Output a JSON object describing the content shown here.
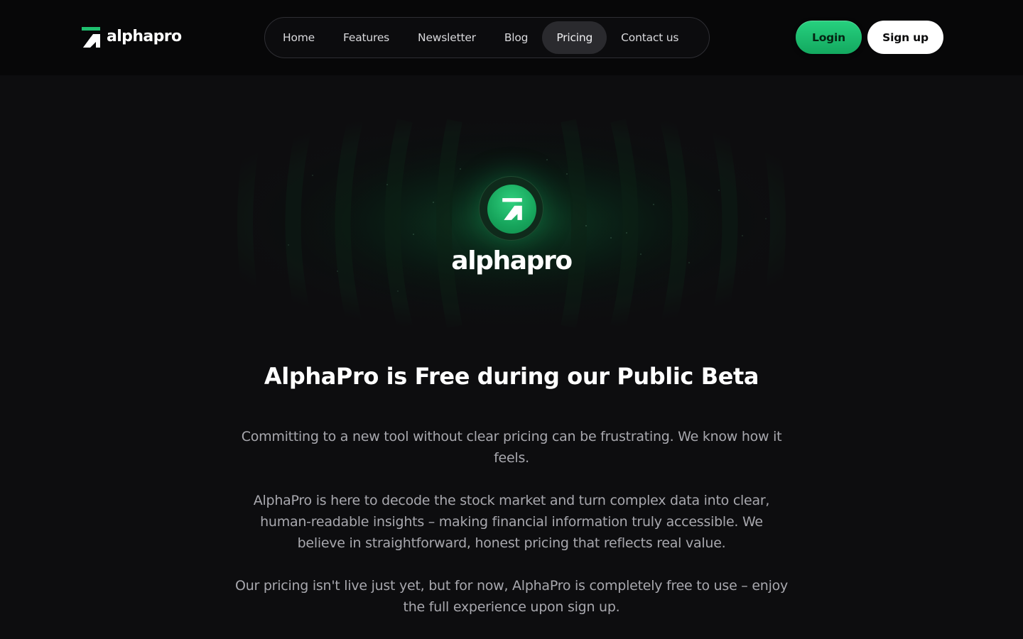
{
  "header": {
    "brand_name": "alphapro",
    "nav": [
      {
        "label": "Home",
        "active": false
      },
      {
        "label": "Features",
        "active": false
      },
      {
        "label": "Newsletter",
        "active": false
      },
      {
        "label": "Blog",
        "active": false
      },
      {
        "label": "Pricing",
        "active": true
      },
      {
        "label": "Contact us",
        "active": false
      }
    ],
    "login_label": "Login",
    "signup_label": "Sign up"
  },
  "hero": {
    "wordmark": "alphapro",
    "icon": "alphapro-logo-icon"
  },
  "main": {
    "headline": "AlphaPro is Free during our Public Beta",
    "paragraphs": [
      "Committing to a new tool without clear pricing can be frustrating. We know how it feels.",
      "AlphaPro is here to decode the stock market and turn complex data into clear, human-readable insights – making financial information truly accessible. We believe in straightforward, honest pricing that reflects real value.",
      "Our pricing isn't live just yet, but for now, AlphaPro is completely free to use – enjoy the full experience upon sign up."
    ]
  },
  "colors": {
    "accent": "#1fbf6f",
    "background": "#0d0d0f",
    "header_bg": "#070708",
    "text_muted": "#a8a8ae"
  }
}
